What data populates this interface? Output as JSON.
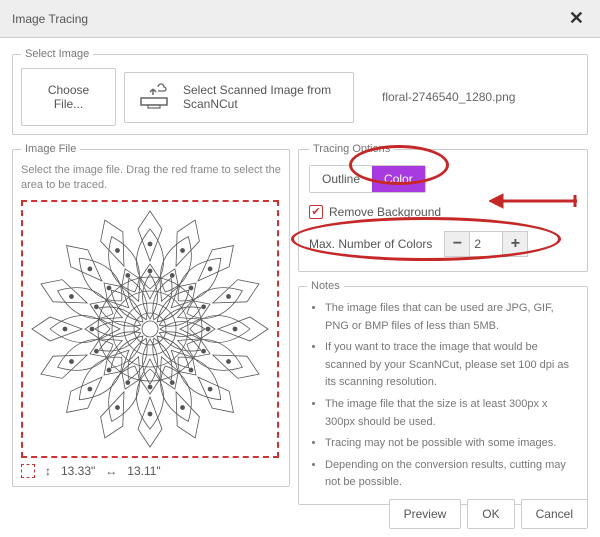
{
  "titlebar": {
    "title": "Image Tracing"
  },
  "selectImage": {
    "legend": "Select Image",
    "chooseFile": "Choose File...",
    "scanncut": "Select Scanned Image from ScanNCut",
    "filename": "floral-2746540_1280.png"
  },
  "imageFile": {
    "legend": "Image File",
    "hint": "Select the image file. Drag the red frame to select the area to be traced.",
    "height": "13.33\"",
    "width": "13.11\""
  },
  "tracing": {
    "legend": "Tracing Options",
    "tabOutline": "Outline",
    "tabColor": "Color",
    "removeBg": "Remove Background",
    "maxColorsLabel": "Max. Number of Colors",
    "maxColorsValue": "2"
  },
  "notes": {
    "legend": "Notes",
    "items": [
      "The image files that can be used are JPG, GIF, PNG or BMP files of less than 5MB.",
      "If you want to trace the image that would be scanned by your ScanNCut, please set 100 dpi as its scanning resolution.",
      "The image file that the size is at least 300px x 300px should be used.",
      "Tracing may not be possible with some images.",
      "Depending on the conversion results, cutting may not be possible."
    ]
  },
  "footer": {
    "preview": "Preview",
    "ok": "OK",
    "cancel": "Cancel"
  }
}
